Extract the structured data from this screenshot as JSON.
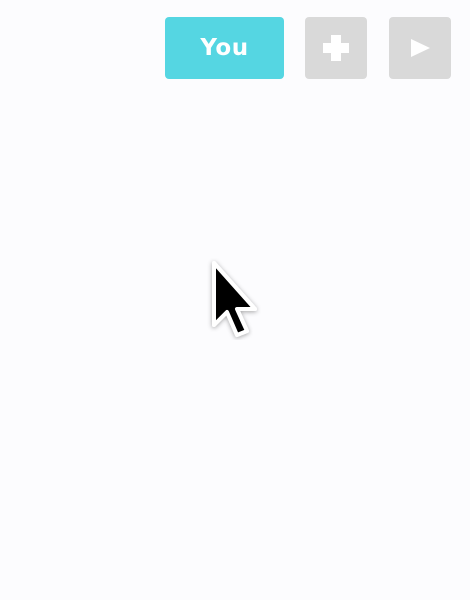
{
  "toolbar": {
    "you_label": "You",
    "add_icon": "plus-icon",
    "play_icon": "play-icon"
  },
  "colors": {
    "background": "#fcfcfe",
    "primary_button": "#55d6e2",
    "inactive_button": "#d9d9d9",
    "icon_glyph": "#ffffff",
    "cursor_fill": "#000000",
    "cursor_outline": "#ffffff"
  },
  "cursor": {
    "icon": "arrow-cursor-icon"
  }
}
